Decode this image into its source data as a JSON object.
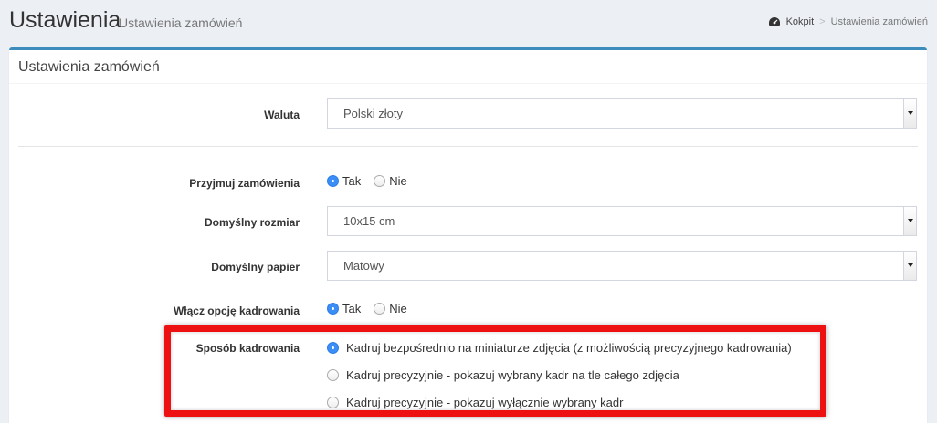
{
  "header": {
    "title": "Ustawienia",
    "subtitle": "Ustawienia zamówień",
    "breadcrumb": {
      "home": "Kokpit",
      "separator": ">",
      "current": "Ustawienia zamówień"
    }
  },
  "box": {
    "title": "Ustawienia zamówień"
  },
  "form": {
    "currency": {
      "label": "Waluta",
      "value": "Polski złoty"
    },
    "accept_orders": {
      "label": "Przyjmuj zamówienia",
      "options": [
        "Tak",
        "Nie"
      ],
      "selected": "Tak"
    },
    "default_size": {
      "label": "Domyślny rozmiar",
      "value": "10x15 cm"
    },
    "default_paper": {
      "label": "Domyślny papier",
      "value": "Matowy"
    },
    "enable_cropping": {
      "label": "Włącz opcję kadrowania",
      "options": [
        "Tak",
        "Nie"
      ],
      "selected": "Tak"
    },
    "cropping_method": {
      "label": "Sposób kadrowania",
      "options": [
        "Kadruj bezpośrednio na miniaturze zdjęcia (z możliwością precyzyjnego kadrowania)",
        "Kadruj precyzyjnie - pokazuj wybrany kadr na tle całego zdjęcia",
        "Kadruj precyzyjnie - pokazuj wyłącznie wybrany kadr"
      ],
      "selected_index": 0
    }
  },
  "colors": {
    "accent": "#3c8dbc",
    "radio_checked": "#3a8ef6",
    "highlight": "#ee1111"
  }
}
